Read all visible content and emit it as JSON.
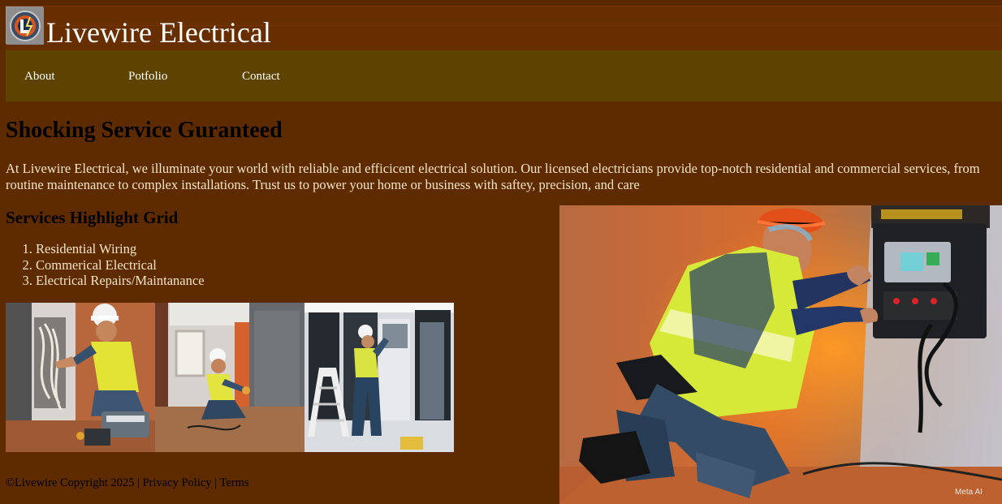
{
  "site": {
    "title": "Livewire Electrical",
    "logo_icon": "livewire-logo-icon"
  },
  "nav": {
    "items": [
      {
        "label": "About"
      },
      {
        "label": "Potfolio"
      },
      {
        "label": "Contact"
      }
    ]
  },
  "hero": {
    "title": "Shocking Service Guranteed",
    "intro": "At Livewire Electrical, we illuminate your world with reliable and efficicent electrical solution. Our licensed electricians provide top-notch residential and commercial services, from routine maintenance to complex installations. Trust us to power your home or business with saftey, precision, and care"
  },
  "services": {
    "title": "Services Highlight Grid",
    "items": [
      "Residential Wiring",
      "Commerical Electrical",
      "Electrical Repairs/Maintanance"
    ]
  },
  "gallery": {
    "images": [
      {
        "name": "residential-wiring-photo"
      },
      {
        "name": "commercial-electrical-photo"
      },
      {
        "name": "electrical-repairs-photo"
      }
    ]
  },
  "hero_image": {
    "name": "electrician-panel-photo",
    "watermark": "Meta AI"
  },
  "footer": {
    "copyright": "©Livewire Copyright 2025",
    "separator": "|",
    "privacy": "Privacy Policy",
    "terms": "Terms"
  },
  "colors": {
    "page_background": "#5e2a00",
    "header_background": "#672e00",
    "nav_background": "#5d4200",
    "heading_text": "#000000",
    "body_text": "#f4e4cc",
    "nav_text": "#ffffff"
  }
}
